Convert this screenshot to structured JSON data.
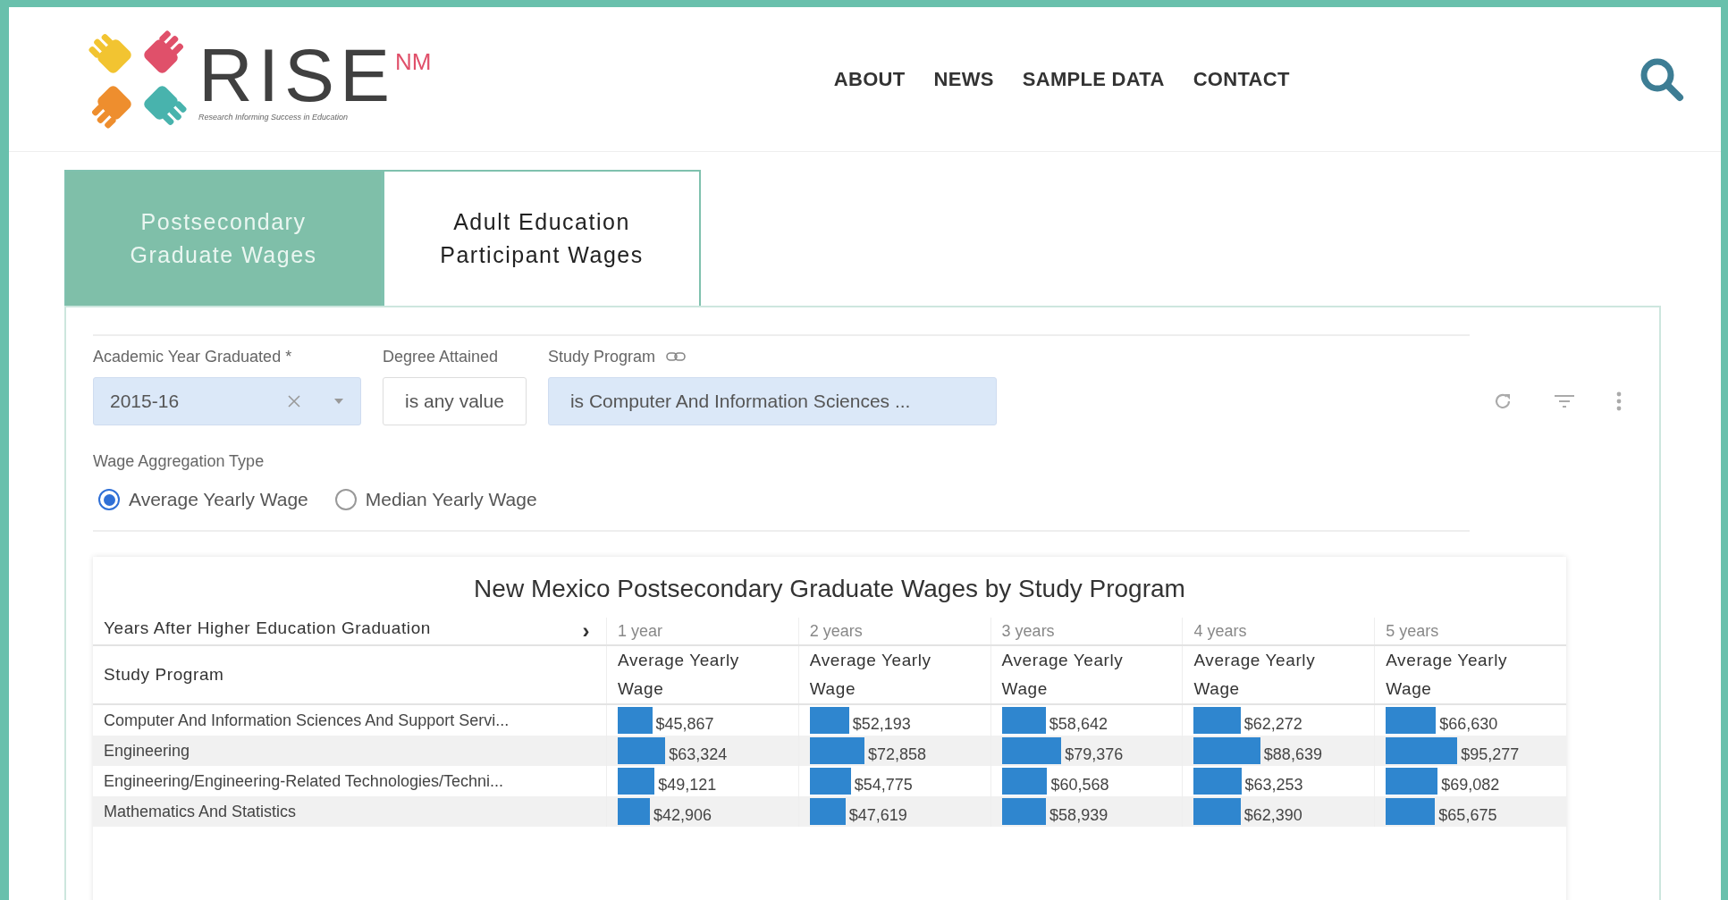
{
  "header": {
    "logo": {
      "name": "RISE",
      "suffix": "NM",
      "tagline": "Research Informing Success in Education"
    },
    "nav": [
      "ABOUT",
      "NEWS",
      "SAMPLE DATA",
      "CONTACT"
    ]
  },
  "tabs": [
    {
      "label": "Postsecondary Graduate Wages",
      "selected": true
    },
    {
      "label": "Adult Education Participant Wages",
      "selected": false
    }
  ],
  "filters": [
    {
      "label": "Academic Year Graduated *",
      "value": "2015-16",
      "kind": "select",
      "active": true
    },
    {
      "label": "Degree Attained",
      "value": "is any value",
      "kind": "plain",
      "active": false
    },
    {
      "label": "Study Program",
      "value": "is Computer And Information Sciences ...",
      "kind": "link",
      "active": true
    }
  ],
  "wage_aggregation": {
    "label": "Wage Aggregation Type",
    "options": [
      {
        "label": "Average Yearly Wage",
        "selected": true
      },
      {
        "label": "Median Yearly Wage",
        "selected": false
      }
    ]
  },
  "table": {
    "title": "New Mexico Postsecondary Graduate Wages by Study Program",
    "pivot_label": "Years After Higher Education Graduation",
    "pivot_arrow": "›",
    "row_header": "Study Program",
    "columns": [
      {
        "period": "1 year",
        "measure": "Average Yearly Wage"
      },
      {
        "period": "2 years",
        "measure": "Average Yearly Wage"
      },
      {
        "period": "3 years",
        "measure": "Average Yearly Wage"
      },
      {
        "period": "4 years",
        "measure": "Average Yearly Wage"
      },
      {
        "period": "5 years",
        "measure": "Average Yearly Wage"
      }
    ],
    "rows": [
      {
        "program": "Computer And Information Sciences And Support Servi...",
        "cells": [
          {
            "value": "$45,867"
          },
          {
            "value": "$52,193"
          },
          {
            "value": "$58,642"
          },
          {
            "value": "$62,272"
          },
          {
            "value": "$66,630"
          }
        ]
      },
      {
        "program": "Engineering",
        "cells": [
          {
            "value": "$63,324"
          },
          {
            "value": "$72,858"
          },
          {
            "value": "$79,376"
          },
          {
            "value": "$88,639"
          },
          {
            "value": "$95,277"
          }
        ]
      },
      {
        "program": "Engineering/Engineering-Related Technologies/Techni...",
        "cells": [
          {
            "value": "$49,121"
          },
          {
            "value": "$54,775"
          },
          {
            "value": "$60,568"
          },
          {
            "value": "$63,253"
          },
          {
            "value": "$69,082"
          }
        ]
      },
      {
        "program": "Mathematics And Statistics",
        "cells": [
          {
            "value": "$42,906"
          },
          {
            "value": "$47,619"
          },
          {
            "value": "$58,939"
          },
          {
            "value": "$62,390"
          },
          {
            "value": "$65,675"
          }
        ]
      }
    ]
  }
}
